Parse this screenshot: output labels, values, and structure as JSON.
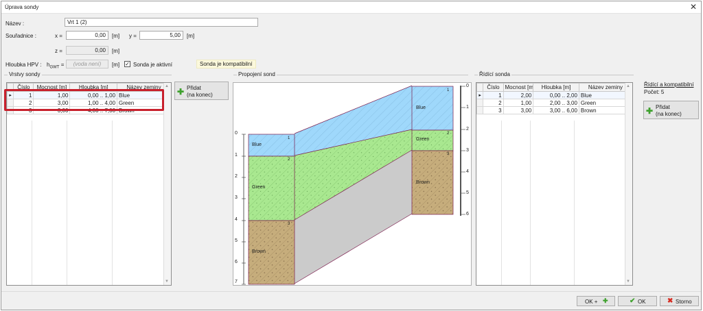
{
  "window": {
    "title": "Úprava sondy",
    "close_symbol": "✕"
  },
  "form": {
    "name_label": "Název :",
    "name_value": "Vrt 1 (2)",
    "coords_label": "Souřadnice :",
    "x_label": "x =",
    "x_value": "0,00",
    "y_label": "y =",
    "y_value": "5,00",
    "z_label": "z =",
    "z_value": "0,00",
    "unit_m": "[m]",
    "gwt_label": "Hloubka HPV :",
    "gwt_h": "h",
    "gwt_sub": "GWT",
    "gwt_eq": "=",
    "gwt_placeholder": "(voda není)",
    "active_label": "Sonda je aktivní",
    "active_checked": "✓",
    "compat_note": "Sonda je kompatibilní"
  },
  "layers": {
    "title": "Vrstvy sondy",
    "columns": [
      "Číslo",
      "Mocnost [m]",
      "Hloubka [m]",
      "Název zeminy"
    ],
    "rows": [
      {
        "num": "1",
        "thickness": "1,00",
        "depth": "0,00 .. 1,00",
        "soil": "Blue"
      },
      {
        "num": "2",
        "thickness": "3,00",
        "depth": "1,00 .. 4,00",
        "soil": "Green"
      },
      {
        "num": "3",
        "thickness": "3,00",
        "depth": "4,00 .. 7,00",
        "soil": "Brown"
      }
    ],
    "current_marker": "▸"
  },
  "add_button": {
    "line1": "Přidat",
    "line2": "(na konec)",
    "icon": "plus-icon"
  },
  "connection": {
    "title": "Propojení sond",
    "left_probe": [
      {
        "label": "Blue",
        "num": "1"
      },
      {
        "label": "Green",
        "num": "2"
      },
      {
        "label": "Brown",
        "num": "3"
      }
    ],
    "right_probe": [
      {
        "label": "Blue",
        "num": "1"
      },
      {
        "label": "Green",
        "num": "2"
      },
      {
        "label": "Brown",
        "num": "3"
      }
    ],
    "left_scale": [
      "0",
      "1",
      "2",
      "3",
      "4",
      "5",
      "6",
      "7"
    ],
    "right_scale": [
      "0",
      "1",
      "2",
      "3",
      "4",
      "5",
      "6"
    ],
    "colors": {
      "blue": "#9fd8fb",
      "green": "#a9e890",
      "brown": "#c6ad7c",
      "gray": "#cbcbcb",
      "border": "#8a1a4a"
    }
  },
  "master": {
    "title": "Řídící sonda",
    "columns": [
      "Číslo",
      "Mocnost [m]",
      "Hloubka [m]",
      "Název zeminy"
    ],
    "rows": [
      {
        "num": "1",
        "thickness": "2,00",
        "depth": "0,00 .. 2,00",
        "soil": "Blue"
      },
      {
        "num": "2",
        "thickness": "1,00",
        "depth": "2,00 .. 3,00",
        "soil": "Green"
      },
      {
        "num": "3",
        "thickness": "3,00",
        "depth": "3,00 .. 6,00",
        "soil": "Brown"
      }
    ],
    "current_marker": "▸",
    "info1": "Řídící a kompatibilní",
    "info2": "Počet: 5"
  },
  "footer": {
    "ok_plus": "OK +",
    "ok": "OK",
    "cancel": "Storno"
  }
}
